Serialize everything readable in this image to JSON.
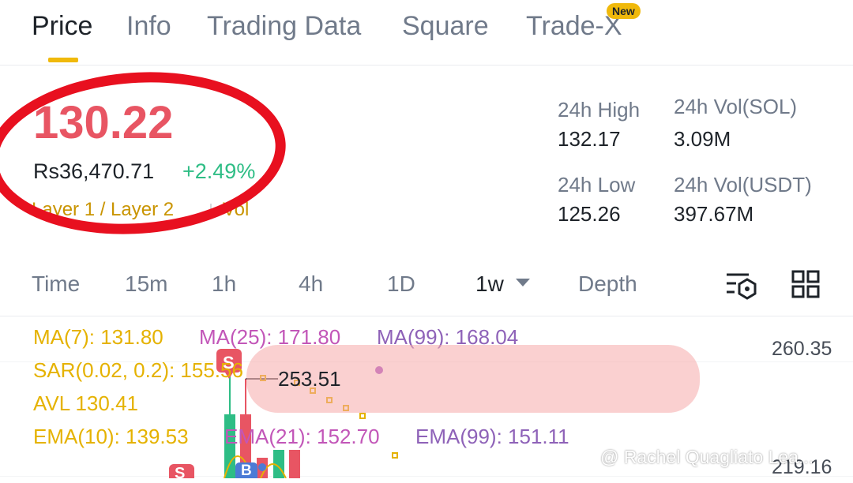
{
  "tabs": [
    {
      "label": "Price"
    },
    {
      "label": "Info"
    },
    {
      "label": "Trading Data"
    },
    {
      "label": "Square"
    },
    {
      "label": "Trade-X",
      "badge": "New"
    }
  ],
  "price": {
    "last": "130.22",
    "local": "Rs36,470.71",
    "change": "+2.49%",
    "tags": "Layer 1 / Layer 2",
    "vol_link": "Vol"
  },
  "stats": {
    "high_label": "24h High",
    "high_value": "132.17",
    "vol_sol_label": "24h Vol(SOL)",
    "vol_sol_value": "3.09M",
    "low_label": "24h Low",
    "low_value": "125.26",
    "vol_usdt_label": "24h Vol(USDT)",
    "vol_usdt_value": "397.67M"
  },
  "intervals": [
    {
      "label": "Time"
    },
    {
      "label": "15m"
    },
    {
      "label": "1h"
    },
    {
      "label": "4h"
    },
    {
      "label": "1D"
    },
    {
      "label": "1w"
    },
    {
      "label": "Depth"
    }
  ],
  "indicators": {
    "ma7": "MA(7): 131.80",
    "ma25": "MA(25): 171.80",
    "ma99": "MA(99): 168.04",
    "sar": "SAR(0.02, 0.2): 155.56",
    "avl": "AVL 130.41",
    "ema10": "EMA(10): 139.53",
    "ema21": "EMA(21): 152.70",
    "ema99": "EMA(99): 151.11"
  },
  "chart": {
    "y_top": "260.35",
    "y_bottom": "219.16",
    "marker_price": "253.51",
    "sell_marker": "S",
    "buy_marker": "B"
  },
  "watermark": "@ Rachel Quagliato Lea...",
  "colors": {
    "accent": "#f0b90b",
    "down": "#e85563",
    "up": "#2ebd85",
    "ma25": "#c256b8",
    "ma99": "#8e62b8"
  },
  "icons": [
    "chart-settings-icon",
    "grid-layout-icon",
    "chevron-down-icon"
  ]
}
